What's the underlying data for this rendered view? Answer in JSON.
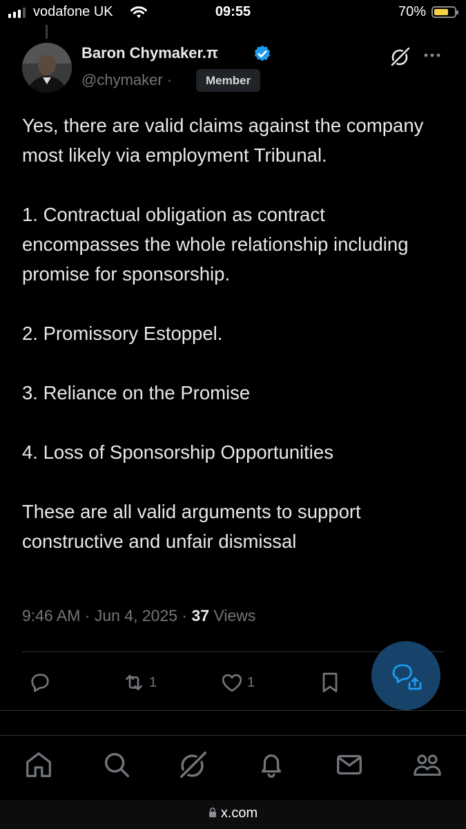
{
  "status_bar": {
    "carrier": "vodafone UK",
    "time": "09:55",
    "battery_percent_label": "70%",
    "battery_level": 0.7
  },
  "post": {
    "author_name": "Baron Chymaker.π",
    "handle": "@chymaker",
    "separator": "·",
    "badge": "Member",
    "paragraphs": [
      "Yes, there are valid claims against the company most likely via employment Tribunal.",
      "1. Contractual obligation as contract encompasses the whole relationship including promise for sponsorship.",
      "2. Promissory Estoppel.",
      "3. Reliance on the Promise",
      "4. Loss of Sponsorship Opportunities",
      "These are all valid arguments to support constructive and unfair dismissal"
    ],
    "timestamp": "9:46 AM · Jun 4, 2025 · ",
    "views_count": "37",
    "views_label": " Views"
  },
  "actions": {
    "reply_icon": "reply-icon",
    "repost_count": "1",
    "like_count": "1",
    "bookmark_icon": "bookmark-icon"
  },
  "tab_bar": {
    "icons": [
      "home-icon",
      "search-icon",
      "grok-icon",
      "notifications-icon",
      "messages-icon",
      "communities-icon"
    ]
  },
  "browser": {
    "url": "x.com"
  },
  "colors": {
    "background": "#000000",
    "text": "#e7e9ea",
    "secondary": "#71767b",
    "verified": "#1d9bf0",
    "fab": "#17436a",
    "battery": "#f7d046"
  }
}
